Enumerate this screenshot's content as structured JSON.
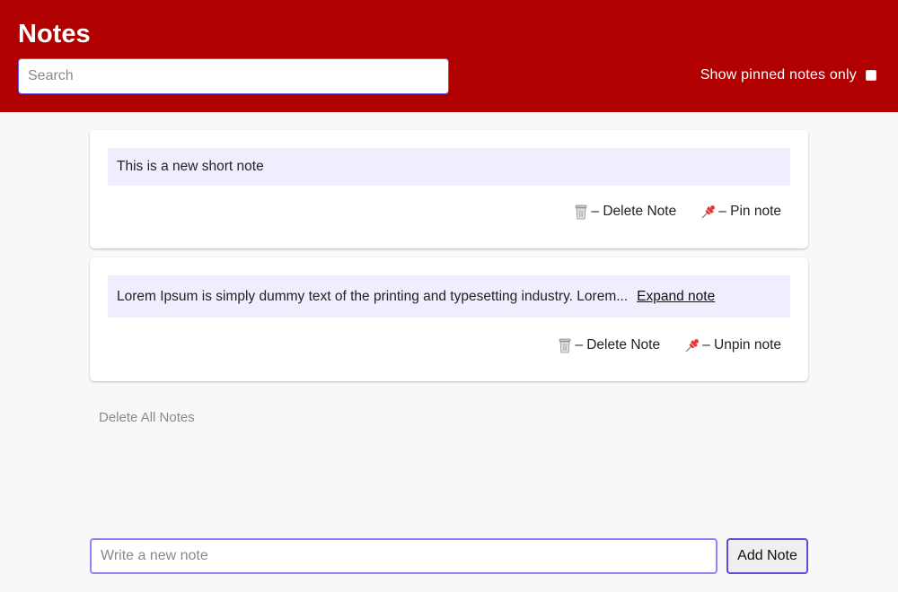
{
  "header": {
    "title": "Notes",
    "search_placeholder": "Search",
    "pinned_filter_label": "Show pinned notes only",
    "pinned_filter_checked": false,
    "background_color": "#b00000"
  },
  "notes": [
    {
      "text": "This is a new short note",
      "delete_label": "– Delete Note",
      "pin_label": "– Pin note",
      "pinned": false
    },
    {
      "text": "Lorem Ipsum is simply dummy text of the printing and typesetting industry. Lorem...",
      "expand_label": "Expand note",
      "delete_label": "– Delete Note",
      "pin_label": "– Unpin note",
      "pinned": true
    }
  ],
  "icons": {
    "delete": "trash-can-icon",
    "pin": "pushpin-icon"
  },
  "delete_all_label": "Delete All Notes",
  "composer": {
    "placeholder": "Write a new note",
    "value": "",
    "add_button_label": "Add Note"
  },
  "colors": {
    "accent": "#6a5cf0",
    "note_background": "#eeeeff",
    "muted_text": "#8a8a8a"
  }
}
